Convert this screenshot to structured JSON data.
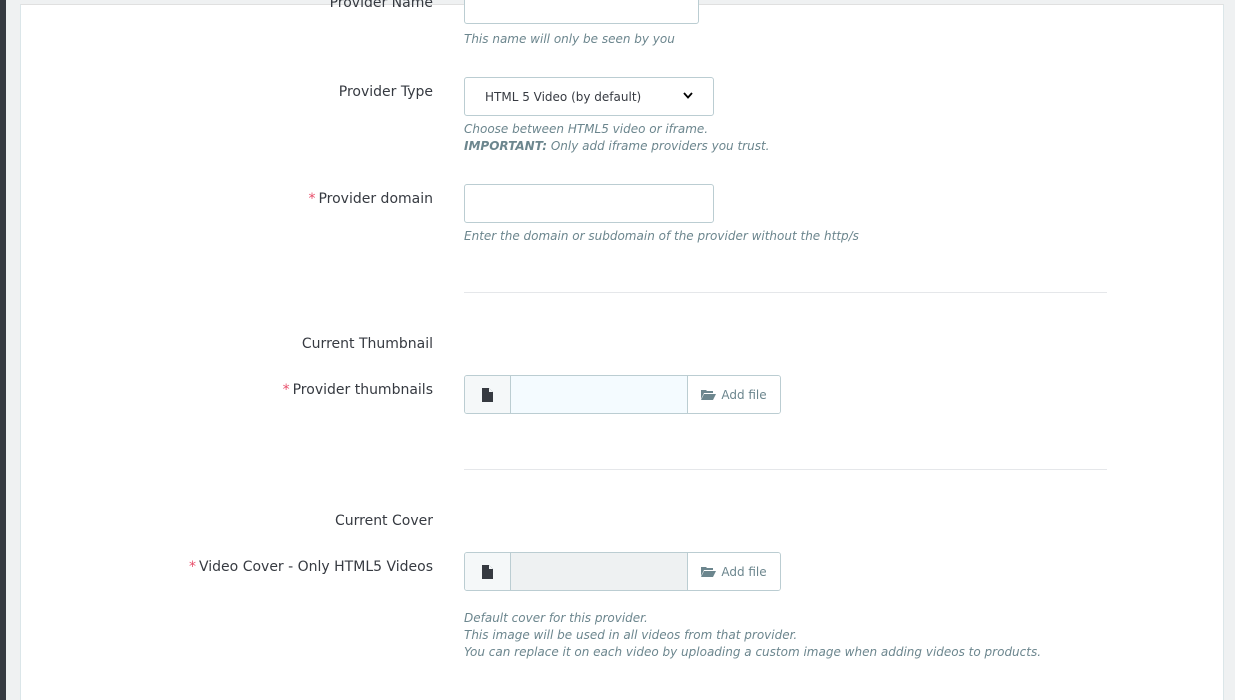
{
  "form": {
    "provider_name": {
      "label": "Provider Name",
      "value": "",
      "help": "This name will only be seen by you"
    },
    "provider_type": {
      "label": "Provider Type",
      "selected": "HTML 5 Video (by default)",
      "help_line1": "Choose between HTML5 video or iframe.",
      "help_important": "IMPORTANT:",
      "help_line2": " Only add iframe providers you trust."
    },
    "provider_domain": {
      "required_mark": "*",
      "label": "Provider domain",
      "value": "",
      "help": "Enter the domain or subdomain of the provider without the http/s"
    },
    "current_thumbnail": {
      "label": "Current Thumbnail"
    },
    "provider_thumbnails": {
      "required_mark": "*",
      "label": "Provider thumbnails",
      "add_label": "Add file"
    },
    "current_cover": {
      "label": "Current Cover"
    },
    "video_cover": {
      "required_mark": "*",
      "label": "Video Cover - Only HTML5 Videos",
      "add_label": "Add file",
      "help_line1": "Default cover for this provider.",
      "help_line2": "This image will be used in all videos from that provider.",
      "help_line3": "You can replace it on each video by uploading a custom image when adding videos to products."
    }
  }
}
